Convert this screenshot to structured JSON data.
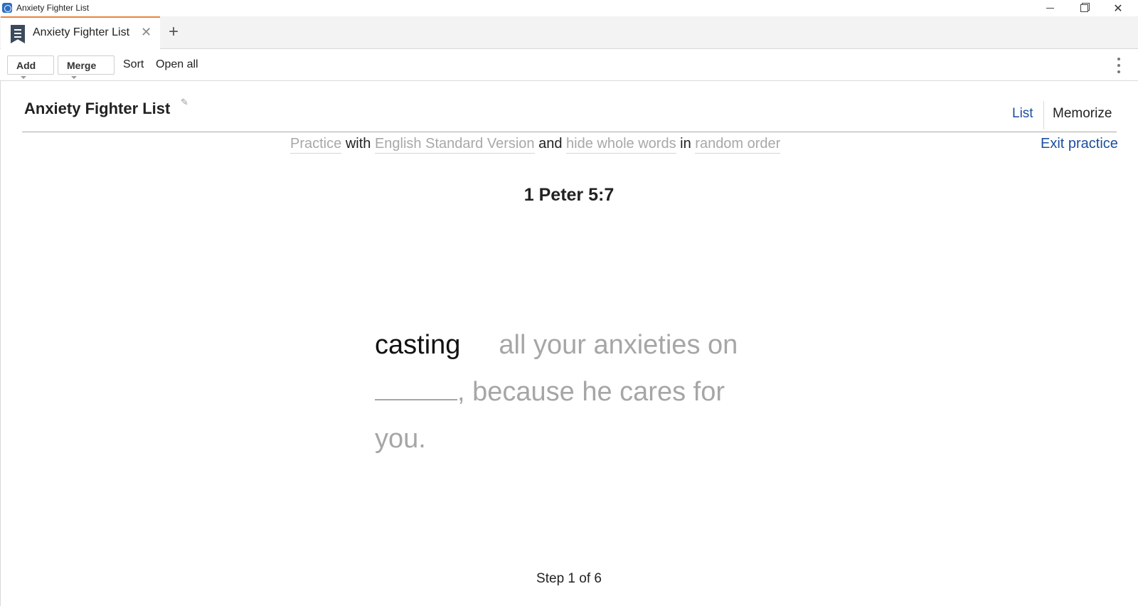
{
  "window": {
    "title": "Anxiety Fighter List"
  },
  "tabs": [
    {
      "label": "Anxiety Fighter List",
      "active": true
    }
  ],
  "toolbar": {
    "add_label": "Add",
    "merge_label": "Merge",
    "sort_label": "Sort",
    "open_all_label": "Open all"
  },
  "header": {
    "title": "Anxiety Fighter List",
    "view_list": "List",
    "view_memorize": "Memorize"
  },
  "practice": {
    "mode": "Practice",
    "with": "with",
    "version": "English Standard Version",
    "and": "and",
    "hide": "hide whole words",
    "in": "in",
    "order": "random order",
    "exit_label": "Exit practice"
  },
  "verse": {
    "reference": "1 Peter 5:7",
    "shown_word": "casting",
    "line1_rest": "all your anxieties on",
    "line2_rest": ", because he cares for",
    "line3": "you."
  },
  "step_text": "Step 1 of 6",
  "colors": {
    "accent_tab": "#e8843a",
    "link_blue": "#1c4e9e",
    "hidden_text": "#a6a6a6"
  },
  "icons": {
    "app": "logos-app-icon",
    "tab": "bookmark-list-icon",
    "edit": "pencil-icon",
    "more": "vertical-ellipsis-icon"
  }
}
